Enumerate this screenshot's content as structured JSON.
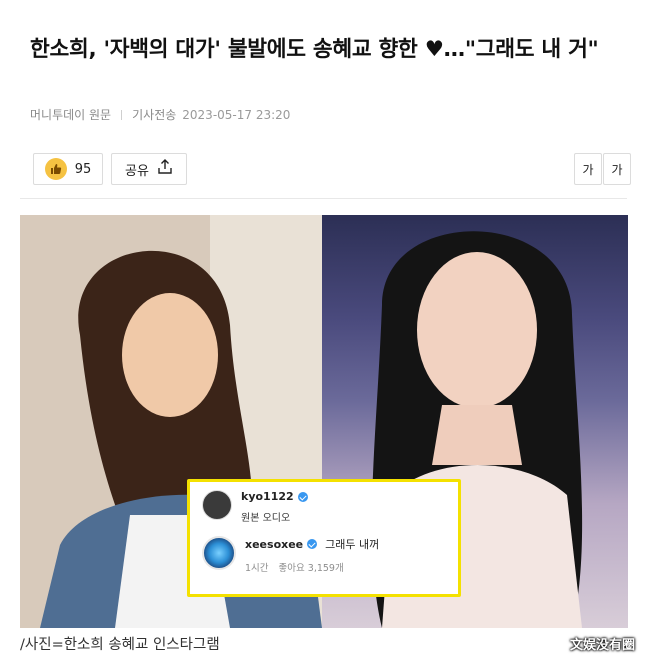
{
  "article": {
    "title": "한소희, '자백의 대가' 불발에도 송혜교 향한 ♥…\"그래도 내 거\"",
    "source": "머니투데이 원문",
    "transmit_label": "기사전송",
    "timestamp": "2023-05-17 23:20"
  },
  "toolbar": {
    "like_icon": "thumbs-up-icon",
    "like_count": "95",
    "share_label": "공유",
    "share_icon": "share-upload-icon",
    "font_small_label": "가",
    "font_large_label": "가"
  },
  "photo": {
    "instagram_card": {
      "user1": "kyo1122",
      "user1_sub": "원본 오디오",
      "user2": "xeesoxee",
      "user2_comment": "그래두 내꺼",
      "time": "1시간",
      "likes": "좋아요 3,159개"
    },
    "caption": "/사진=한소희 송혜교 인스타그램",
    "watermark": "文娱没有圈"
  },
  "colors": {
    "highlight_border": "#f4e100",
    "like_badge": "#f5c242",
    "verified": "#3897f0"
  }
}
